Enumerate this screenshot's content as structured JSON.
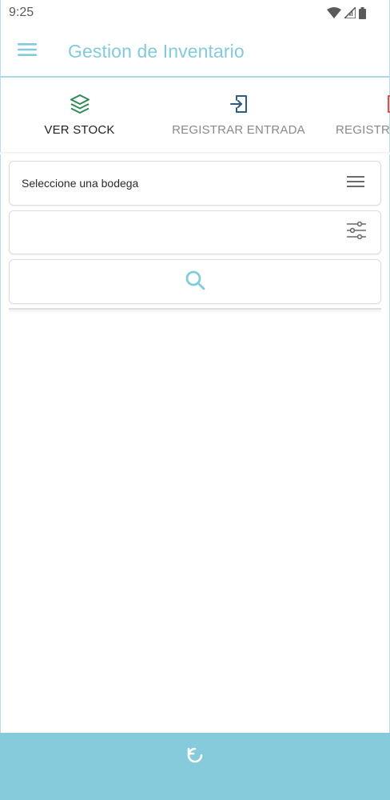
{
  "status_bar": {
    "time": "9:25",
    "icons": [
      "wifi-icon",
      "cell-signal-icon",
      "battery-icon"
    ]
  },
  "app_bar": {
    "title": "Gestion de Inventario",
    "menu_icon": "hamburger-menu-icon"
  },
  "tabs": [
    {
      "label": "VER STOCK",
      "icon": "layers-icon",
      "icon_color": "#2e8b57",
      "selected": true
    },
    {
      "label": "REGISTRAR ENTRADA",
      "icon": "login-arrow-icon",
      "icon_color": "#2c5b8a",
      "selected": false
    },
    {
      "label": "REGISTRAR SALIDA",
      "icon": "logout-arrow-icon",
      "icon_color": "#e05050",
      "selected": false
    }
  ],
  "form": {
    "bodega_select": {
      "selected_text": "Seleccione una bodega",
      "icon": "list-lines-icon"
    },
    "filter_input": {
      "value": "",
      "placeholder": "",
      "icon": "sliders-icon"
    },
    "search_button": {
      "icon": "search-icon",
      "icon_color": "#83cadc"
    }
  },
  "bottom_bar": {
    "icon": "refresh-icon"
  },
  "colors": {
    "accent": "#83cadc",
    "bottom_bar": "#85cbdb",
    "tab_inactive_text": "#8a8a8a",
    "tab_active_text": "#222222"
  }
}
